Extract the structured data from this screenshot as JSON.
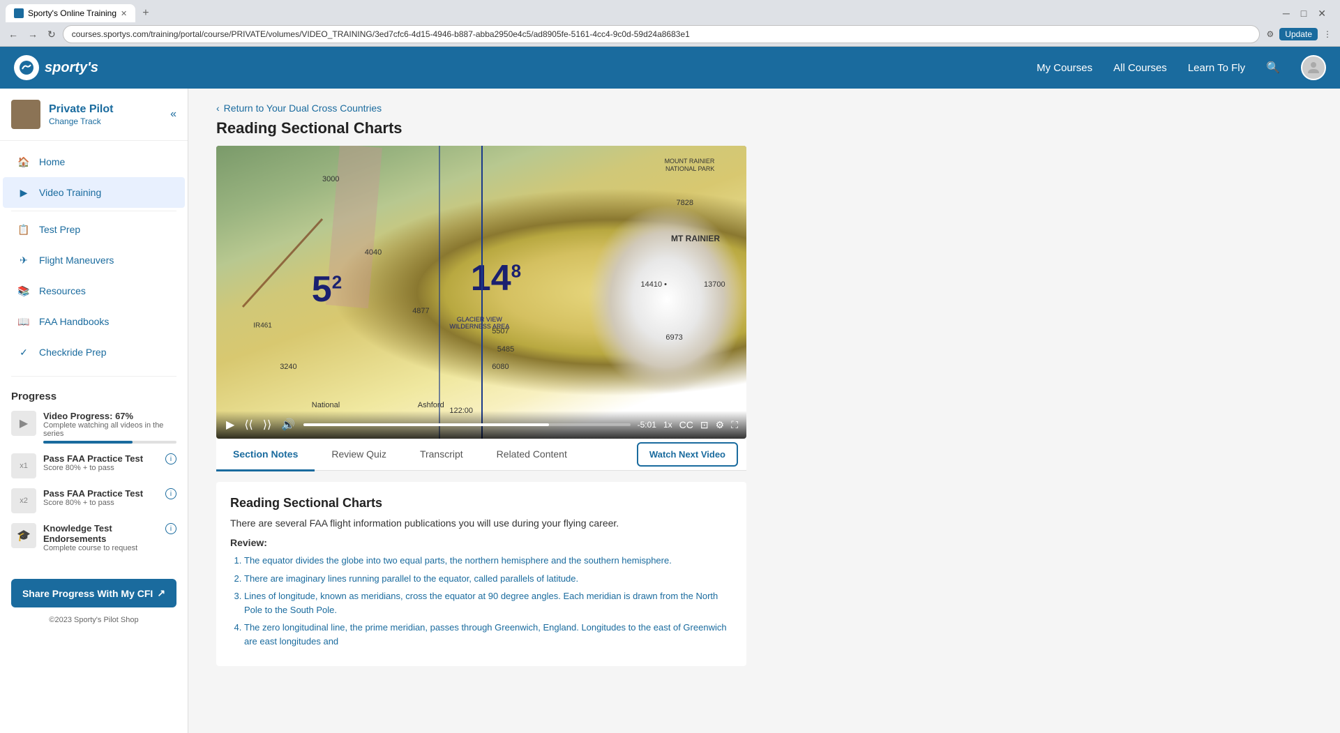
{
  "browser": {
    "tab_title": "Sporty's Online Training",
    "url": "courses.sportys.com/training/portal/course/PRIVATE/volumes/VIDEO_TRAINING/3ed7cfc6-4d15-4946-b887-abba2950e4c5/ad8905fe-5161-4cc4-9c0d-59d24a8683e1",
    "update_label": "Update"
  },
  "header": {
    "logo_text": "sporty's",
    "nav": {
      "my_courses": "My Courses",
      "all_courses": "All Courses",
      "learn_to_fly": "Learn To Fly"
    }
  },
  "sidebar": {
    "course_title": "Private Pilot",
    "course_subtitle": "Change Track",
    "nav_items": [
      {
        "id": "home",
        "label": "Home",
        "icon": "home-icon"
      },
      {
        "id": "video-training",
        "label": "Video Training",
        "icon": "video-icon",
        "active": true
      },
      {
        "id": "test-prep",
        "label": "Test Prep",
        "icon": "document-icon"
      },
      {
        "id": "flight-maneuvers",
        "label": "Flight Maneuvers",
        "icon": "plane-icon"
      },
      {
        "id": "resources",
        "label": "Resources",
        "icon": "book-icon"
      },
      {
        "id": "faa-handbooks",
        "label": "FAA Handbooks",
        "icon": "faa-icon"
      },
      {
        "id": "checkride-prep",
        "label": "Checkride Prep",
        "icon": "checkride-icon"
      }
    ],
    "progress": {
      "title": "Progress",
      "items": [
        {
          "label": "Video Progress: 67%",
          "sub": "Complete watching all videos in the series",
          "fill": 67
        },
        {
          "label": "Pass FAA Practice Test",
          "sub": "Score 80% + to pass",
          "badge": "x1"
        },
        {
          "label": "Pass FAA Practice Test",
          "sub": "Score 80% + to pass",
          "badge": "x2"
        },
        {
          "label": "Knowledge Test Endorsements",
          "sub": "Complete course to request"
        }
      ]
    },
    "share_btn": "Share Progress With My CFI",
    "copyright": "©2023 Sporty's Pilot Shop"
  },
  "main": {
    "back_link": "Return to Your Dual Cross Countries",
    "page_title": "Reading Sectional Charts",
    "video": {
      "time_remaining": "-5:01",
      "speed": "1x",
      "progress_pct": 75
    },
    "tabs": [
      {
        "id": "section-notes",
        "label": "Section Notes",
        "active": true
      },
      {
        "id": "review-quiz",
        "label": "Review Quiz"
      },
      {
        "id": "transcript",
        "label": "Transcript"
      },
      {
        "id": "related-content",
        "label": "Related Content"
      }
    ],
    "watch_next_btn": "Watch Next Video",
    "content": {
      "title": "Reading Sectional Charts",
      "intro": "There are several FAA flight information publications you will use during your flying career.",
      "review_label": "Review:",
      "list_items": [
        "The equator divides the globe into two equal parts, the northern hemisphere and the southern hemisphere.",
        "There are imaginary lines running parallel to the equator, called parallels of latitude.",
        "Lines of longitude, known as meridians, cross the equator at 90 degree angles. Each meridian is drawn from the North Pole to the South Pole.",
        "The zero longitudinal line, the prime meridian, passes through Greenwich, England. Longitudes to the east of Greenwich are east longitudes and"
      ]
    }
  }
}
